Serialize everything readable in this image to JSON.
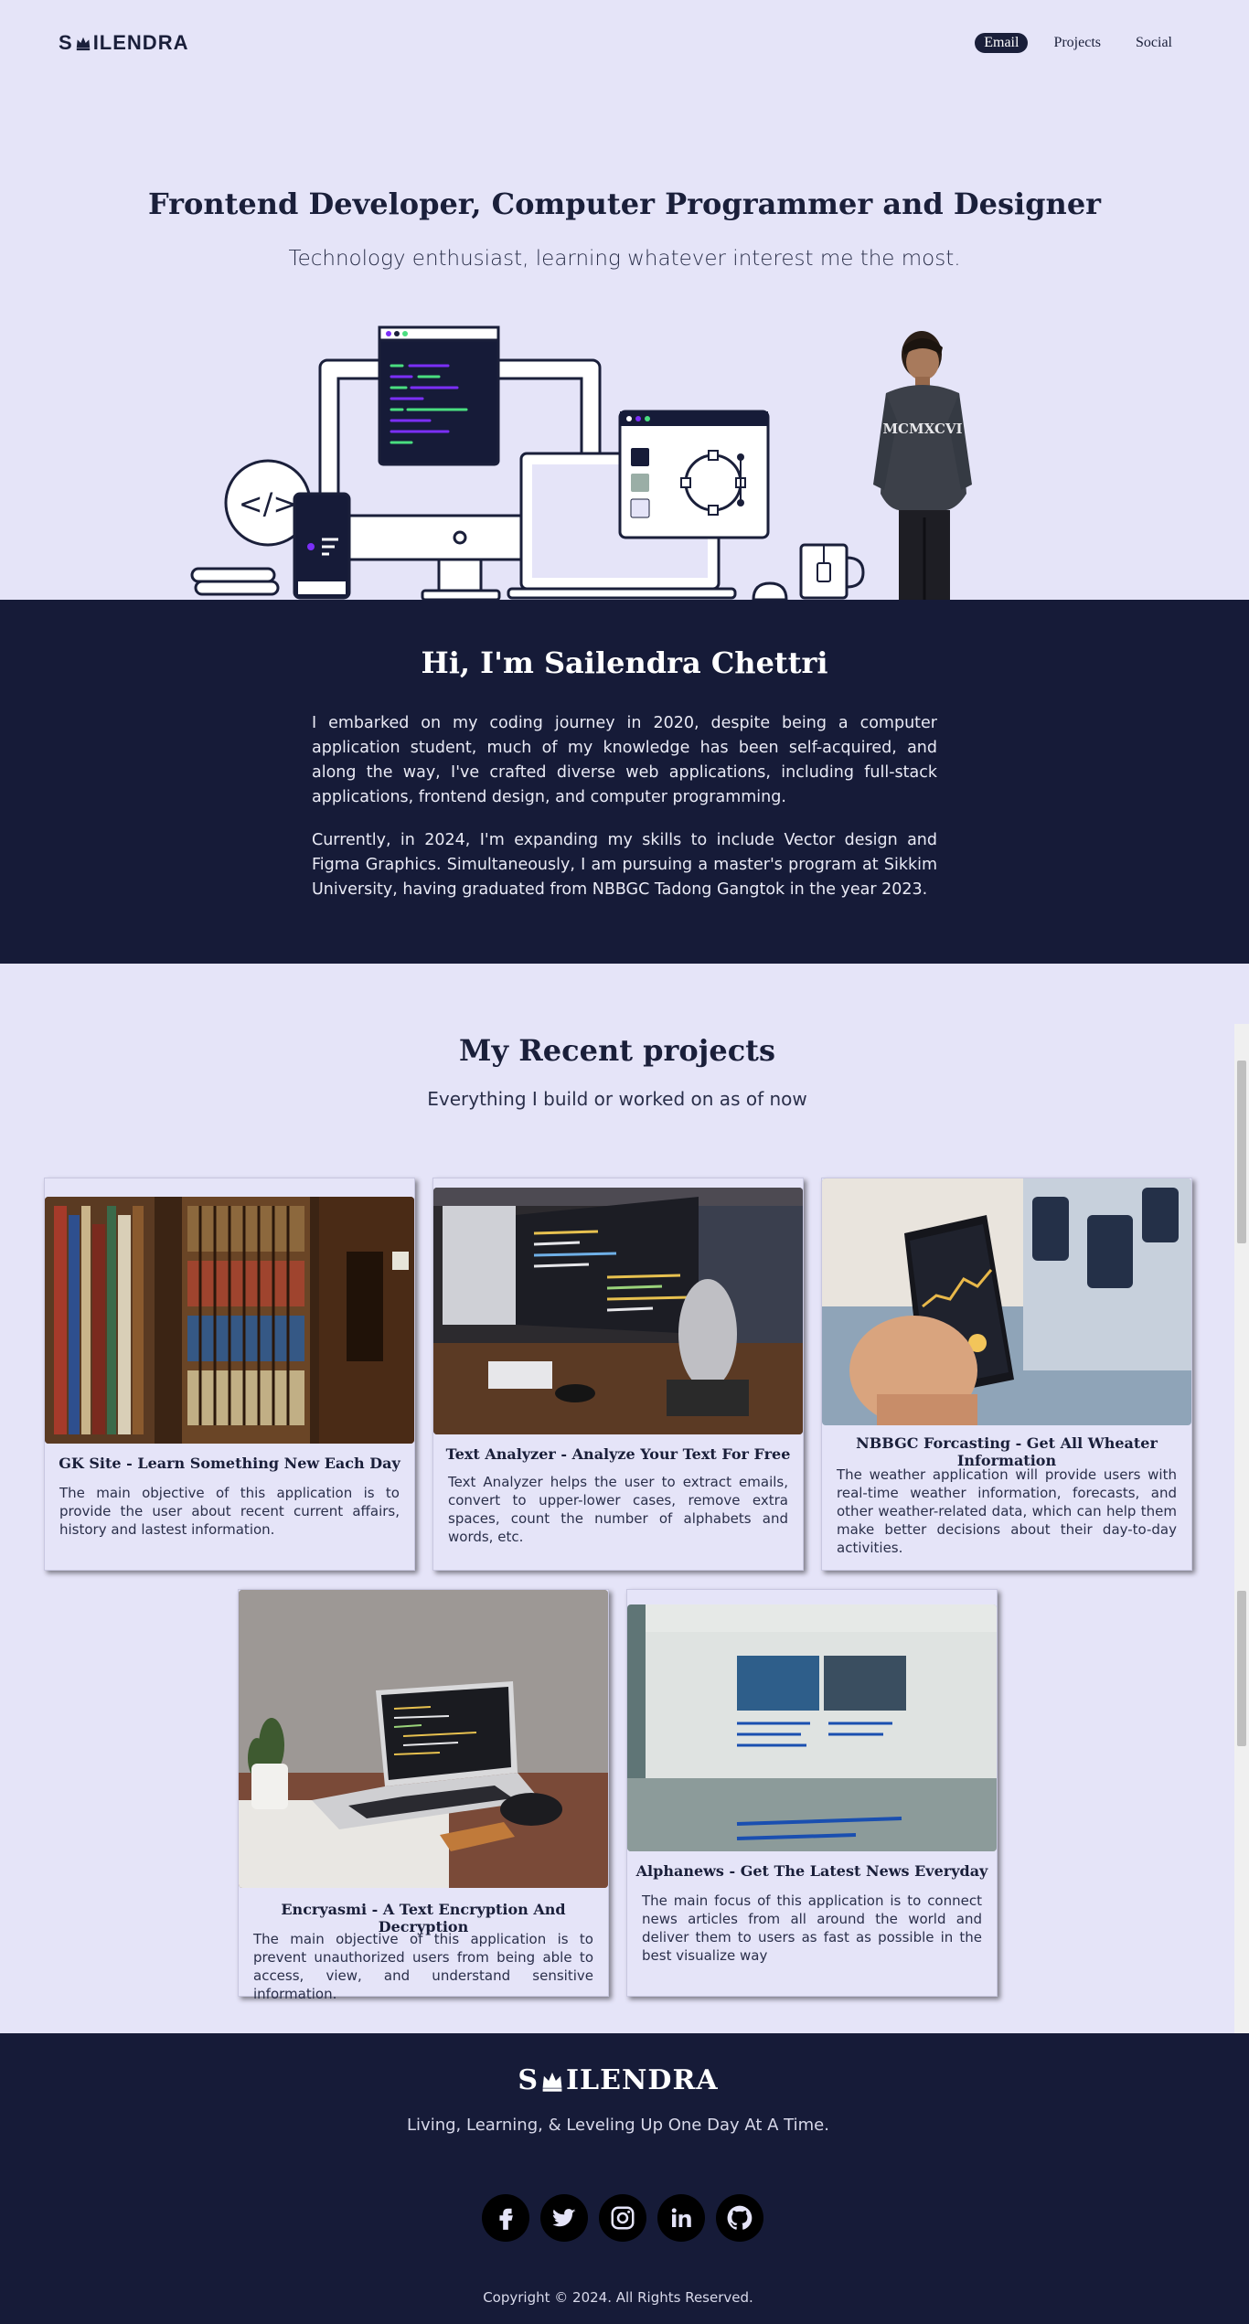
{
  "header": {
    "logo_text": "SAILENDRA",
    "logo_prefix": "S",
    "logo_suffix": "ILENDRA",
    "nav": [
      {
        "label": "Email",
        "active": true
      },
      {
        "label": "Projects",
        "active": false
      },
      {
        "label": "Social",
        "active": false
      }
    ]
  },
  "hero": {
    "title": "Frontend Developer, Computer Programmer and Designer",
    "subtitle": "Technology enthusiast, learning whatever interest me the most."
  },
  "about": {
    "heading": "Hi, I'm Sailendra Chettri",
    "paragraph1": "I embarked on my coding journey in 2020, despite being a computer application student, much of my knowledge has been self-acquired, and along the way, I've crafted diverse web applications, including full-stack applications, frontend design, and computer programming.",
    "paragraph2": "Currently, in 2024, I'm expanding my skills to include Vector design and Figma Graphics. Simultaneously, I am pursuing a master's program at Sikkim University, having graduated from NBBGC Tadong Gangtok in the year 2023."
  },
  "projects": {
    "title": "My Recent projects",
    "subtitle": "Everything I build or worked on as of now",
    "cards": [
      {
        "title": "GK Site - Learn Something New Each Day",
        "description": "The main objective of this application is to provide the user about recent current affairs, history and lastest information.",
        "image": "library-bookshelves"
      },
      {
        "title": "Text Analyzer - Analyze Your Text For Free",
        "description": "Text Analyzer helps the user to extract emails, convert to upper-lower cases, remove extra spaces, count the number of alphabets and words, etc.",
        "image": "code-monitor-desk"
      },
      {
        "title": "NBBGC Forcasting - Get All Wheater Information",
        "description": "The weather application will provide users with real-time weather information, forecasts, and other weather-related data, which can help them make better decisions about their day-to-day activities.",
        "image": "phone-finance-app"
      },
      {
        "title": "Encryasmi - A Text Encryption And Decryption",
        "description": "The main objective of this application is to prevent unauthorized users from being able to access, view, and understand sensitive information.",
        "image": "laptop-code"
      },
      {
        "title": "Alphanews - Get The Latest News Everyday",
        "description": "The main focus of this application is to connect news articles from all around the world and deliver them to users as fast as possible in the best visualize way",
        "image": "news-screen"
      }
    ]
  },
  "footer": {
    "logo_prefix": "S",
    "logo_suffix": "ILENDRA",
    "tagline": "Living, Learning, & Leveling Up One Day At A Time.",
    "socials": [
      "facebook-icon",
      "twitter-icon",
      "instagram-icon",
      "linkedin-icon",
      "github-icon"
    ],
    "copyright": "Copyright © 2024. All Rights Reserved."
  },
  "colors": {
    "background": "#e5e4f8",
    "dark": "#161b38",
    "accent": "#7b2ff7",
    "code_green": "#4ade80"
  }
}
